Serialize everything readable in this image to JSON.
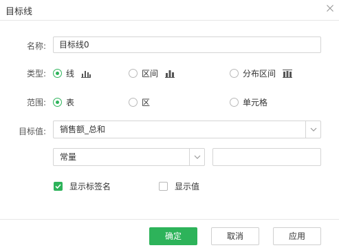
{
  "dialog": {
    "title": "目标线"
  },
  "name_field": {
    "label": "名称:",
    "value": "目标线0"
  },
  "type_field": {
    "label": "类型:",
    "options": [
      {
        "label": "线",
        "checked": true,
        "icon": "bar-chart-icon"
      },
      {
        "label": "区间",
        "checked": false,
        "icon": "bar-chart-icon"
      },
      {
        "label": "分布区间",
        "checked": false,
        "icon": "distribution-icon"
      }
    ]
  },
  "range_field": {
    "label": "范围:",
    "options": [
      {
        "label": "表",
        "checked": true
      },
      {
        "label": "区",
        "checked": false
      },
      {
        "label": "单元格",
        "checked": false
      }
    ]
  },
  "target_field": {
    "label": "目标值:",
    "selected": "销售额_总和"
  },
  "const_field": {
    "selected": "常量",
    "value": ""
  },
  "checkboxes": [
    {
      "label": "显示标签名",
      "checked": true
    },
    {
      "label": "显示值",
      "checked": false
    }
  ],
  "buttons": {
    "ok": "确定",
    "cancel": "取消",
    "apply": "应用"
  },
  "colors": {
    "accent": "#2db35a",
    "border": "#d4d4d4"
  }
}
